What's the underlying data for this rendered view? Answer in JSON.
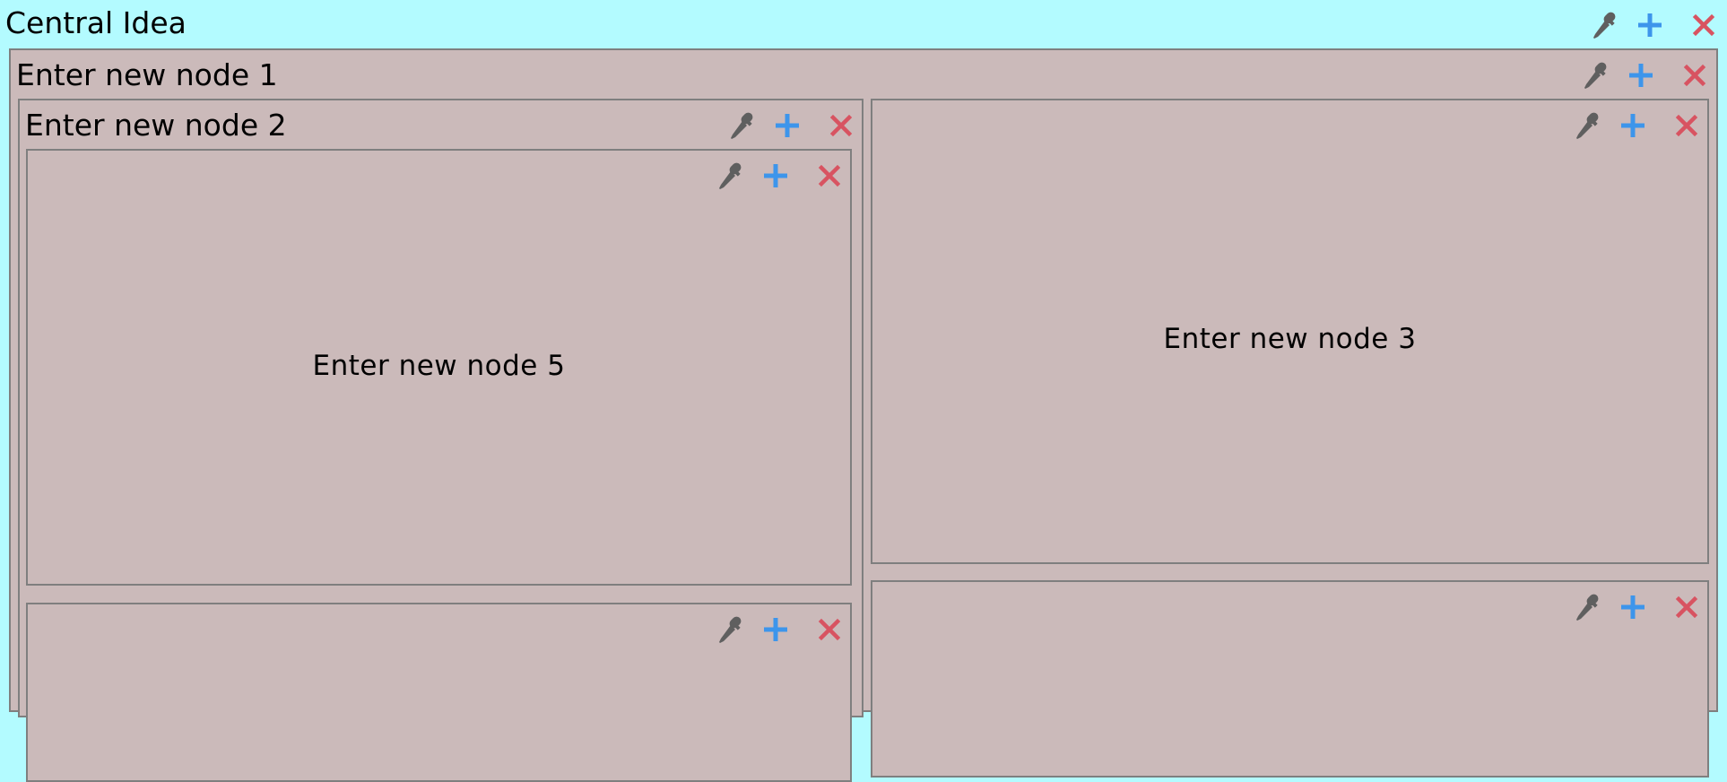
{
  "colors": {
    "root_background": "#b3fbff",
    "node_background": "#cbbaba",
    "node_border": "#7f7f7f",
    "color_icon": "#5f5f5f",
    "add_icon": "#3d95eb",
    "delete_icon": "#d85361"
  },
  "icons": {
    "color": "eyedropper-icon",
    "add": "plus-icon",
    "delete": "close-icon"
  },
  "root": {
    "title": "Central Idea"
  },
  "nodes": {
    "node1": {
      "title": "Enter new node 1"
    },
    "node2": {
      "title": "Enter new node 2"
    },
    "node3": {
      "title": "Enter new node 3"
    },
    "node5": {
      "title": "Enter new node 5"
    },
    "node6": {
      "title": ""
    },
    "node4": {
      "title": ""
    }
  }
}
